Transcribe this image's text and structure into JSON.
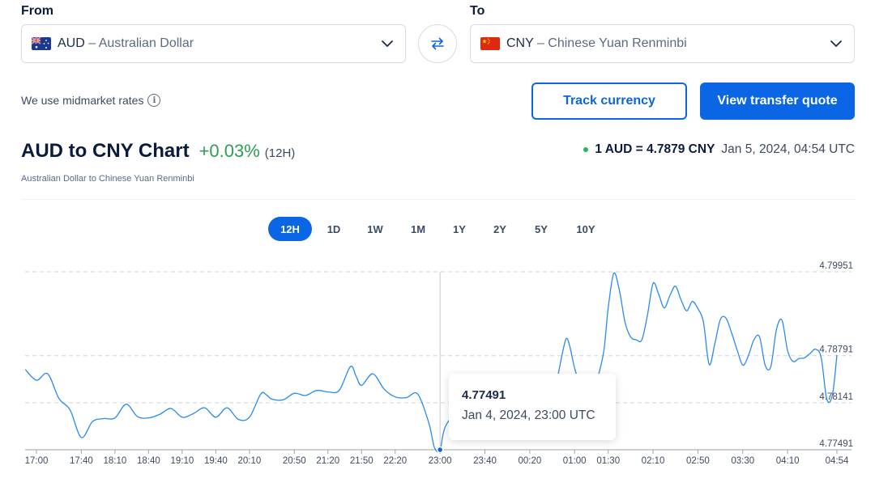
{
  "converter": {
    "from_label": "From",
    "to_label": "To",
    "from_code": "AUD",
    "from_name": "– Australian Dollar",
    "to_code": "CNY",
    "to_name": "– Chinese Yuan Renminbi",
    "swap_icon": "swap-arrows-icon"
  },
  "midmarket_text": "We use midmarket rates",
  "buttons": {
    "track": "Track currency",
    "quote": "View transfer quote"
  },
  "chart_header": {
    "title": "AUD to CNY Chart",
    "change": "+0.03%",
    "period": "(12H)",
    "subtitle": "Australian Dollar to Chinese Yuan Renminbi",
    "rate": "1 AUD = 4.7879 CNY",
    "rate_date": "Jan 5, 2024, 04:54 UTC"
  },
  "tabs": [
    {
      "label": "12H",
      "active": true
    },
    {
      "label": "1D",
      "active": false
    },
    {
      "label": "1W",
      "active": false
    },
    {
      "label": "1M",
      "active": false
    },
    {
      "label": "1Y",
      "active": false
    },
    {
      "label": "2Y",
      "active": false
    },
    {
      "label": "5Y",
      "active": false
    },
    {
      "label": "10Y",
      "active": false
    }
  ],
  "tooltip": {
    "value": "4.77491",
    "date": "Jan 4, 2024, 23:00 UTC"
  },
  "colors": {
    "accent": "#0a66e4",
    "line": "#2a8af0",
    "positive": "#2e9d55"
  },
  "chart_data": {
    "type": "line",
    "title": "AUD to CNY Chart",
    "xlabel": "",
    "ylabel": "",
    "ylim": [
      4.77491,
      4.79951
    ],
    "y_ticks": [
      "4.79951",
      "4.78791",
      "4.78141",
      "4.77491"
    ],
    "x_ticks": [
      "17:00",
      "17:40",
      "18:10",
      "18:40",
      "19:10",
      "19:40",
      "20:10",
      "20:50",
      "21:20",
      "21:50",
      "22:20",
      "23:00",
      "23:40",
      "00:20",
      "01:00",
      "01:30",
      "02:10",
      "02:50",
      "03:30",
      "04:10",
      "04:54"
    ],
    "x_ticks_min": [
      0,
      40,
      70,
      100,
      130,
      160,
      190,
      230,
      260,
      290,
      320,
      360,
      400,
      440,
      480,
      510,
      550,
      590,
      630,
      670,
      714
    ],
    "selected_point": {
      "x_min": 360,
      "y": 4.77491
    },
    "series": [
      {
        "x_min": [
          -10,
          0,
          10,
          20,
          30,
          40,
          50,
          60,
          70,
          80,
          90,
          100,
          110,
          120,
          130,
          140,
          150,
          160,
          170,
          180,
          190,
          200,
          205,
          210,
          220,
          230,
          240,
          250,
          260,
          270,
          280,
          285,
          290,
          300,
          310,
          320,
          330,
          340,
          350,
          355,
          360,
          365,
          380,
          390,
          400,
          410,
          420,
          430,
          440,
          450,
          460,
          470,
          473,
          476,
          480,
          486,
          490,
          495,
          500,
          506,
          510,
          515,
          520,
          525,
          530,
          535,
          540,
          545,
          550,
          555,
          560,
          565,
          570,
          575,
          580,
          585,
          590,
          595,
          600,
          605,
          610,
          615,
          620,
          625,
          630,
          635,
          640,
          645,
          650,
          655,
          660,
          665,
          670,
          675,
          680,
          685,
          690,
          695,
          700,
          705,
          710,
          714
        ],
        "values": [
          4.78601,
          4.78451,
          4.78541,
          4.78201,
          4.78041,
          4.77661,
          4.77881,
          4.77921,
          4.77931,
          4.78121,
          4.77951,
          4.77931,
          4.77981,
          4.78061,
          4.77941,
          4.77991,
          4.78071,
          4.77941,
          4.78071,
          4.77911,
          4.77941,
          4.78261,
          4.78251,
          4.78191,
          4.78181,
          4.78271,
          4.78241,
          4.78311,
          4.78291,
          4.78311,
          4.78641,
          4.78511,
          4.78381,
          4.78541,
          4.78331,
          4.78221,
          4.78211,
          4.78261,
          4.77861,
          4.77521,
          4.77491,
          4.77821,
          4.78091,
          4.78001,
          4.78121,
          4.78261,
          4.78351,
          4.78251,
          4.78461,
          4.78461,
          4.78231,
          4.78891,
          4.79031,
          4.78901,
          4.78621,
          4.78331,
          4.78151,
          4.78261,
          4.78451,
          4.78851,
          4.79451,
          4.79931,
          4.79691,
          4.79251,
          4.79051,
          4.79011,
          4.79011,
          4.79351,
          4.79791,
          4.79641,
          4.79451,
          4.79621,
          4.79751,
          4.79561,
          4.79411,
          4.79541,
          4.79441,
          4.79251,
          4.78671,
          4.78951,
          4.79291,
          4.79311,
          4.79111,
          4.78871,
          4.78661,
          4.78791,
          4.79011,
          4.79051,
          4.78661,
          4.78641,
          4.79151,
          4.79281,
          4.78861,
          4.78711,
          4.78751,
          4.78761,
          4.78821,
          4.78881,
          4.78761,
          4.78191,
          4.78251,
          4.78801
        ]
      }
    ]
  }
}
